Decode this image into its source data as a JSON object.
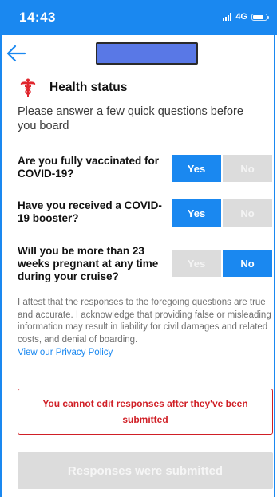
{
  "status_bar": {
    "time": "14:43",
    "network": "4G",
    "signal_icon": "signal-bars-icon",
    "battery_icon": "battery-icon"
  },
  "nav": {
    "back_icon": "arrow-left-icon",
    "title_redacted": true
  },
  "section": {
    "icon": "caduceus-icon",
    "title": "Health status",
    "intro": "Please answer a few quick questions before you board"
  },
  "questions": [
    {
      "text": "Are you fully vaccinated for COVID-19?",
      "yes_label": "Yes",
      "no_label": "No",
      "selected": "yes"
    },
    {
      "text": "Have you received a COVID-19 booster?",
      "yes_label": "Yes",
      "no_label": "No",
      "selected": "yes"
    },
    {
      "text": "Will you be more than 23 weeks pregnant at any time during your cruise?",
      "yes_label": "Yes",
      "no_label": "No",
      "selected": "no"
    }
  ],
  "attestation": "I attest that the responses to the foregoing questions are true and accurate. I acknowledge that providing false or misleading information may result in liability for civil damages and related costs, and denial of boarding.",
  "privacy_link": "View our Privacy Policy",
  "warning": "You cannot edit responses after they've been submitted",
  "submit_button": "Responses were submitted",
  "colors": {
    "primary": "#1a88f0",
    "warning": "#d01f26",
    "disabled": "#dcdcdc",
    "brand_icon": "#e0262d"
  }
}
